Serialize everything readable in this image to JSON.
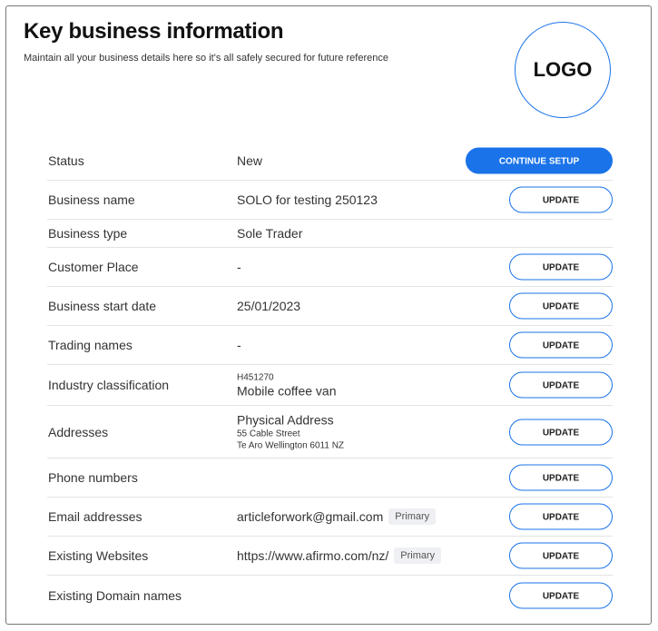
{
  "header": {
    "title": "Key business information",
    "subtitle": "Maintain all your business details here so it's all safely secured for future reference",
    "logo_text": "LOGO"
  },
  "buttons": {
    "continue_setup": "CONTINUE SETUP",
    "update": "UPDATE"
  },
  "rows": {
    "status": {
      "label": "Status",
      "value": "New"
    },
    "business_name": {
      "label": "Business name",
      "value": "SOLO for testing 250123"
    },
    "business_type": {
      "label": "Business type",
      "value": "Sole Trader"
    },
    "customer_place": {
      "label": "Customer Place",
      "value": "-"
    },
    "start_date": {
      "label": "Business start date",
      "value": "25/01/2023"
    },
    "trading_names": {
      "label": "Trading names",
      "value": "-"
    },
    "industry": {
      "label": "Industry classification",
      "code": "H451270",
      "value": "Mobile coffee van"
    },
    "addresses": {
      "label": "Addresses",
      "type": "Physical Address",
      "line1": "55 Cable Street",
      "line2": "Te Aro Wellington 6011 NZ"
    },
    "phone": {
      "label": "Phone numbers",
      "value": ""
    },
    "email": {
      "label": "Email addresses",
      "value": "articleforwork@gmail.com",
      "badge": "Primary"
    },
    "websites": {
      "label": "Existing Websites",
      "value": "https://www.afirmo.com/nz/",
      "badge": "Primary"
    },
    "domains": {
      "label": "Existing Domain names",
      "value": ""
    }
  },
  "colors": {
    "accent": "#1a73e8",
    "divider": "#e3e3e3",
    "badge_bg": "#eef0f3"
  }
}
